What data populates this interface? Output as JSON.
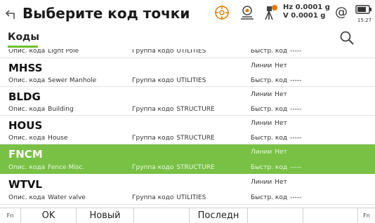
{
  "title": "Выберите код точки",
  "status": {
    "hz_line": "Hz 0.0001 g",
    "v_line": "V  0.0001 g",
    "at_symbol": "@",
    "time": "15:27"
  },
  "tabs": {
    "codes": "Коды"
  },
  "labels": {
    "desc": "Опис. кода",
    "group": "Группа кодо",
    "quick": "Быстр. код",
    "lines": "Линии"
  },
  "list": {
    "partial_row": {
      "desc": "Light Pole",
      "group": "UTILITIES",
      "quick": "-----"
    },
    "rows": [
      {
        "code": "MHSS",
        "desc": "Sewer Manhole",
        "group": "UTILITIES",
        "lines": "Нет",
        "quick": "-----"
      },
      {
        "code": "BLDG",
        "desc": "Building",
        "group": "STRUCTURE",
        "lines": "Нет",
        "quick": "-----"
      },
      {
        "code": "HOUS",
        "desc": "House",
        "group": "STRUCTURE",
        "lines": "Нет",
        "quick": "-----"
      },
      {
        "code": "FNCM",
        "desc": "Fence Misc.",
        "group": "STRUCTURE",
        "lines": "Нет",
        "quick": "-----",
        "selected": true
      },
      {
        "code": "WTVL",
        "desc": "Water valve",
        "group": "UTILITIES",
        "lines": "Нет",
        "quick": "-----"
      }
    ]
  },
  "softkeys": {
    "fn_left": "Fn",
    "ok": "OK",
    "new": "Новый",
    "last": "Последн",
    "fn_right": "Fn"
  },
  "colors": {
    "accent": "#79c145",
    "underline": "#6fbf2b"
  }
}
